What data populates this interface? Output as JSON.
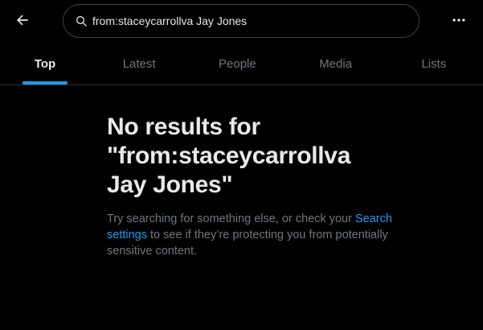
{
  "header": {
    "search_value": "from:staceycarrollva Jay Jones",
    "back_icon": "arrow-left-icon",
    "search_icon": "search-icon",
    "more_icon": "more-horizontal-icon"
  },
  "tabs": [
    {
      "label": "Top",
      "active": true
    },
    {
      "label": "Latest",
      "active": false
    },
    {
      "label": "People",
      "active": false
    },
    {
      "label": "Media",
      "active": false
    },
    {
      "label": "Lists",
      "active": false
    }
  ],
  "empty_state": {
    "title": "No results for \"from:staceycarrollva Jay Jones\"",
    "body_prefix": "Try searching for something else, or check your",
    "link_text": "Search settings",
    "body_suffix": "to see if they’re protecting you from potentially sensitive content."
  },
  "colors": {
    "background": "#000000",
    "accent": "#1d9bf0",
    "text_primary": "#e7e9ea",
    "text_secondary": "#71767b",
    "border": "#2f3336"
  }
}
